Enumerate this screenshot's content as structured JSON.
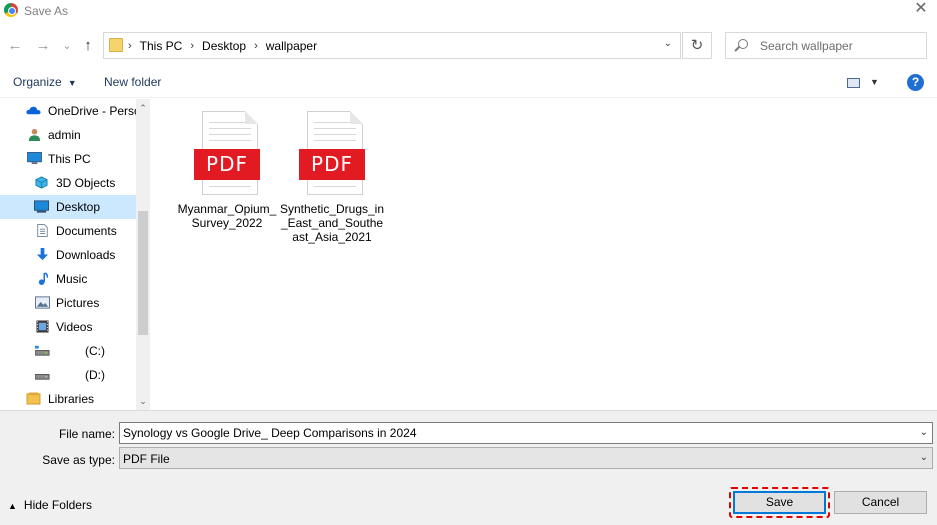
{
  "window": {
    "title": "Save As",
    "close_glyph": "✕"
  },
  "nav": {
    "back": "←",
    "forward": "→",
    "recent": "⌄",
    "up": "↑"
  },
  "address": {
    "crumbs": [
      "This PC",
      "Desktop",
      "wallpaper"
    ],
    "separator": "›",
    "dropdown": "⌄",
    "refresh": "↻"
  },
  "search": {
    "placeholder": "Search wallpaper",
    "value": ""
  },
  "toolbar": {
    "organize": "Organize",
    "organize_caret": "▼",
    "new_folder": "New folder",
    "view_caret": "▼",
    "help": "?"
  },
  "sidebar": {
    "items": [
      {
        "label": "OneDrive - Perso",
        "icon": "cloud-icon",
        "level": 1
      },
      {
        "label": "admin",
        "icon": "user-icon",
        "level": 1
      },
      {
        "label": "This PC",
        "icon": "computer-icon",
        "level": 1
      },
      {
        "label": "3D Objects",
        "icon": "cube-icon",
        "level": 2
      },
      {
        "label": "Desktop",
        "icon": "desktop-icon",
        "level": 2,
        "selected": true
      },
      {
        "label": "Documents",
        "icon": "document-icon",
        "level": 2
      },
      {
        "label": "Downloads",
        "icon": "download-icon",
        "level": 2
      },
      {
        "label": "Music",
        "icon": "music-icon",
        "level": 2
      },
      {
        "label": "Pictures",
        "icon": "pictures-icon",
        "level": 2
      },
      {
        "label": "Videos",
        "icon": "video-icon",
        "level": 2
      },
      {
        "label": "(C:)",
        "icon": "drive-icon",
        "level": 2
      },
      {
        "label": "(D:)",
        "icon": "drive-icon",
        "level": 2
      },
      {
        "label": "Libraries",
        "icon": "library-icon",
        "level": 1
      }
    ],
    "scroll_up": "⌃",
    "scroll_down": "⌄"
  },
  "files": [
    {
      "name": "Myanmar_Opium_Survey_2022",
      "type_badge": "PDF"
    },
    {
      "name": "Synthetic_Drugs_in_East_and_Southeast_Asia_2021",
      "type_badge": "PDF"
    }
  ],
  "form": {
    "file_name_label": "File name:",
    "file_name_value": "Synology vs Google Drive_ Deep Comparisons in 2024",
    "save_type_label": "Save as type:",
    "save_type_value": "PDF File",
    "dropdown": "⌄"
  },
  "footer": {
    "hide_folders": "Hide Folders",
    "hide_caret": "▲",
    "save": "Save",
    "cancel": "Cancel"
  },
  "colors": {
    "accent": "#0078d7",
    "selection": "#cce8ff",
    "pdf_red": "#e21a22",
    "highlight": "#e00000"
  }
}
